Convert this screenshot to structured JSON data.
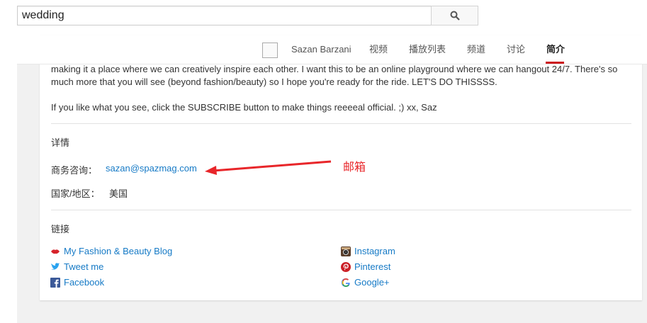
{
  "search": {
    "query": "wedding"
  },
  "nav": {
    "channel_name": "Sazan Barzani",
    "tabs": [
      "视频",
      "播放列表",
      "频道",
      "讨论",
      "简介"
    ],
    "active_tab": "简介"
  },
  "about": {
    "description_1": "making it a place where we can creatively inspire each other. I want this to be an online playground where we can hangout 24/7. There's so much more that you will see (beyond fashion/beauty) so I hope you're ready for the ride. LET'S DO THISSSS.",
    "description_2": "If you like what you see, click the SUBSCRIBE button to make things reeeeal official. ;) xx, Saz",
    "details_heading": "详情",
    "business_label": "商务咨询：",
    "business_email": "sazan@spazmag.com",
    "country_label": "国家/地区：",
    "country_value": "美国",
    "links_heading": "链接",
    "links_left": [
      "My Fashion & Beauty Blog",
      "Tweet me",
      "Facebook"
    ],
    "links_right": [
      "Instagram",
      "Pinterest",
      "Google+"
    ]
  },
  "annotation": {
    "text": "邮箱",
    "color": "#e8262a"
  },
  "colors": {
    "link": "#167ac6",
    "accent": "#cc181e",
    "page_bg": "#f1f1f1"
  }
}
